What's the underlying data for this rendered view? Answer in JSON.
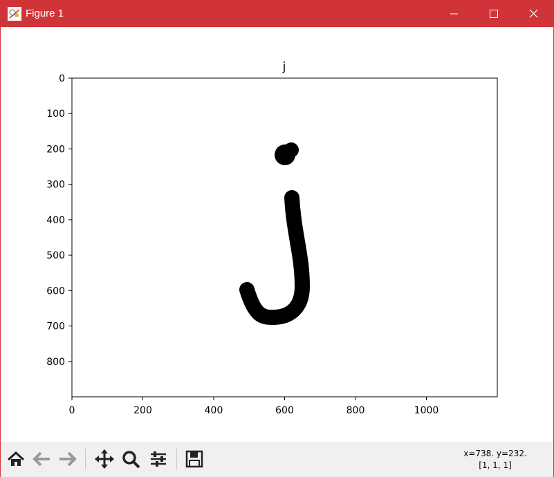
{
  "window": {
    "title": "Figure 1",
    "accent": "#d13438"
  },
  "figure": {
    "plot_title": "j",
    "y_ticks": [
      "0",
      "100",
      "200",
      "300",
      "400",
      "500",
      "600",
      "700",
      "800"
    ],
    "x_ticks": [
      "0",
      "200",
      "400",
      "600",
      "800",
      "1000"
    ]
  },
  "image_content": {
    "description_only": "handwritten black letter on white background",
    "xlim": [
      0,
      1200
    ],
    "ylim": [
      900,
      0
    ]
  },
  "toolbar": {
    "buttons": [
      "home-icon",
      "back-icon",
      "forward-icon",
      "pan-icon",
      "zoom-icon",
      "configure-subplots-icon",
      "save-icon"
    ],
    "coords_line1": "x=738. y=232.",
    "coords_line2": "[1, 1, 1]"
  }
}
